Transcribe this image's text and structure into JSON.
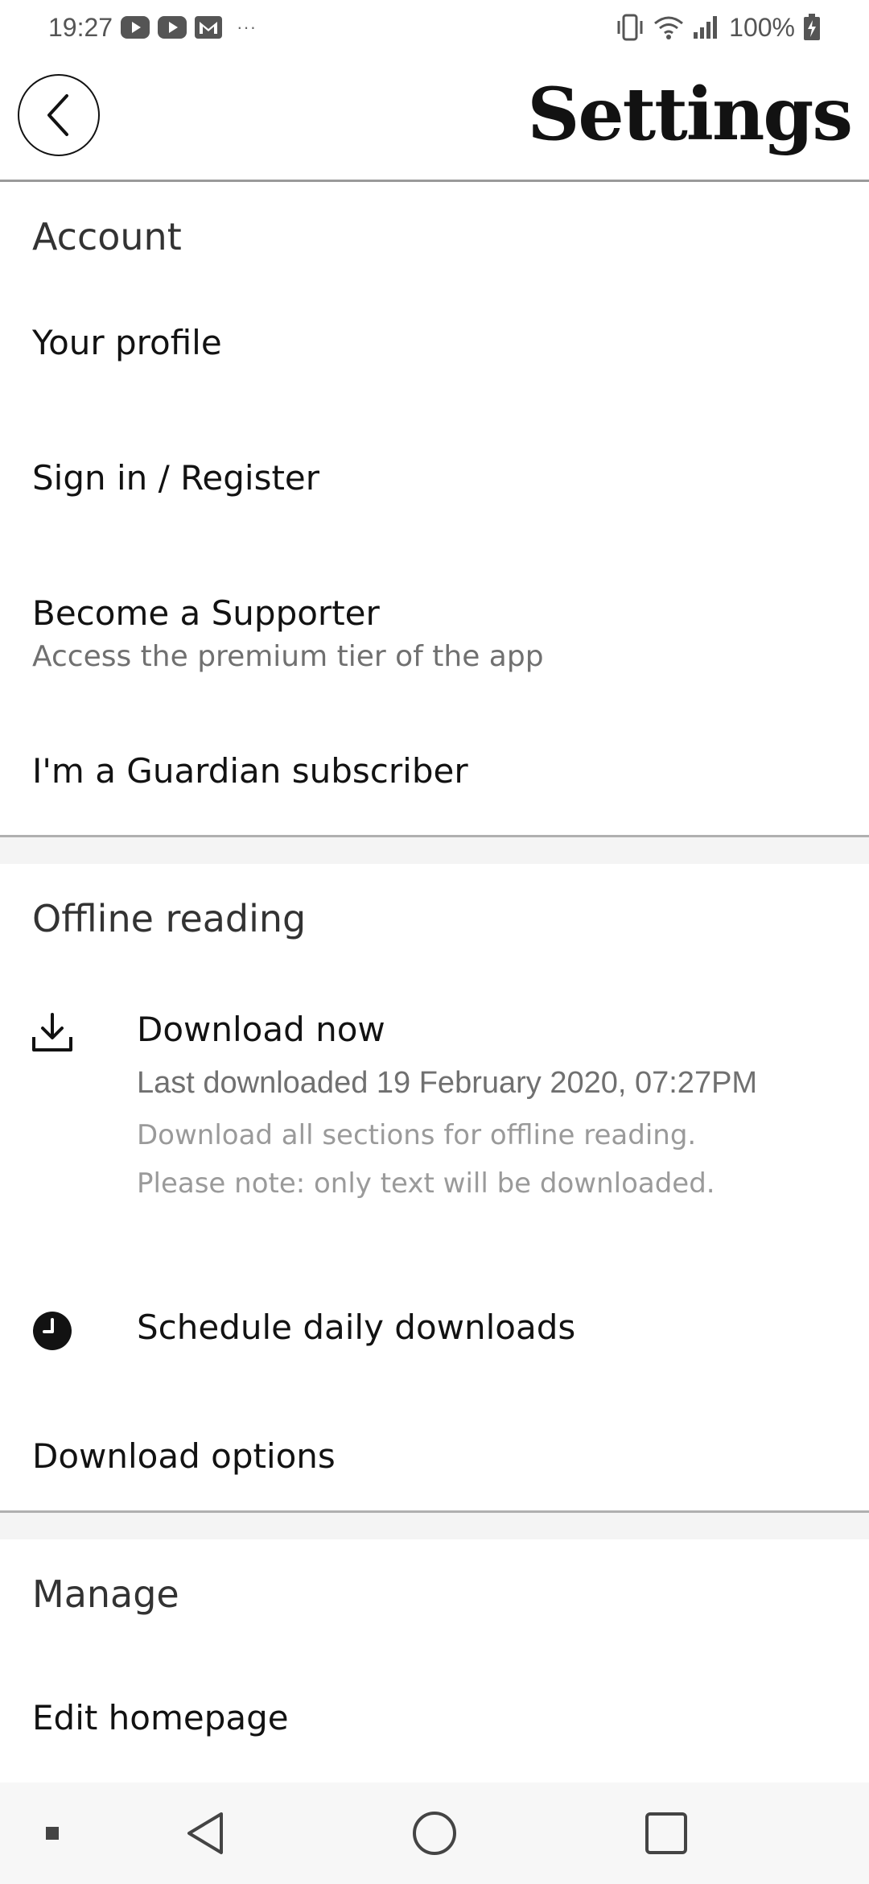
{
  "status_bar": {
    "time": "19:27",
    "dots": "···",
    "battery": "100%"
  },
  "header": {
    "title": "Settings"
  },
  "account": {
    "title": "Account",
    "your_profile": "Your profile",
    "sign_in": "Sign in / Register",
    "supporter_label": "Become a Supporter",
    "supporter_sub": "Access the premium tier of the app",
    "subscriber": "I'm a Guardian subscriber"
  },
  "offline": {
    "title": "Offline reading",
    "download_now": "Download now",
    "last_downloaded": "Last downloaded 19 February 2020, 07:27PM",
    "note_line1": "Download all sections for offline reading.",
    "note_line2": "Please note: only text will be downloaded.",
    "schedule": "Schedule daily downloads",
    "download_options": "Download options"
  },
  "manage": {
    "title": "Manage",
    "edit_homepage": "Edit homepage"
  }
}
